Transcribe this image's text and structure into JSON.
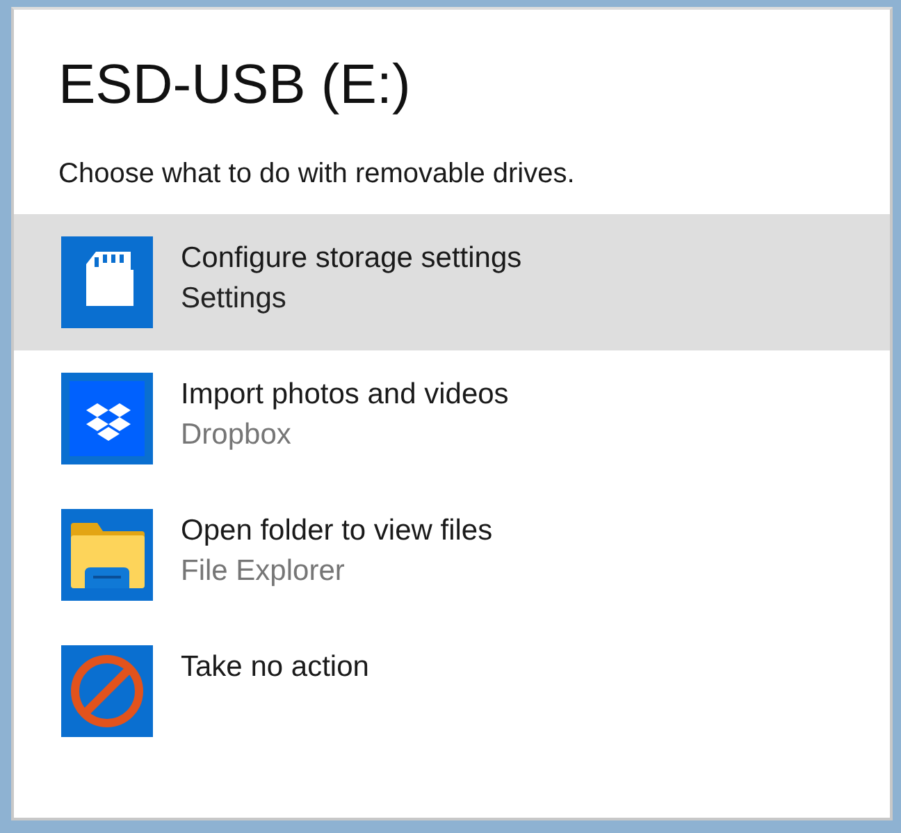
{
  "title": "ESD-USB (E:)",
  "subtitle": "Choose what to do with removable drives.",
  "actions": [
    {
      "kind": "sd-card",
      "label": "Configure storage settings",
      "app": "Settings",
      "selected": true
    },
    {
      "kind": "dropbox",
      "label": "Import photos and videos",
      "app": "Dropbox",
      "selected": false
    },
    {
      "kind": "folder",
      "label": "Open folder to view files",
      "app": "File Explorer",
      "selected": false
    },
    {
      "kind": "no-action",
      "label": "Take no action",
      "selected": false
    }
  ]
}
